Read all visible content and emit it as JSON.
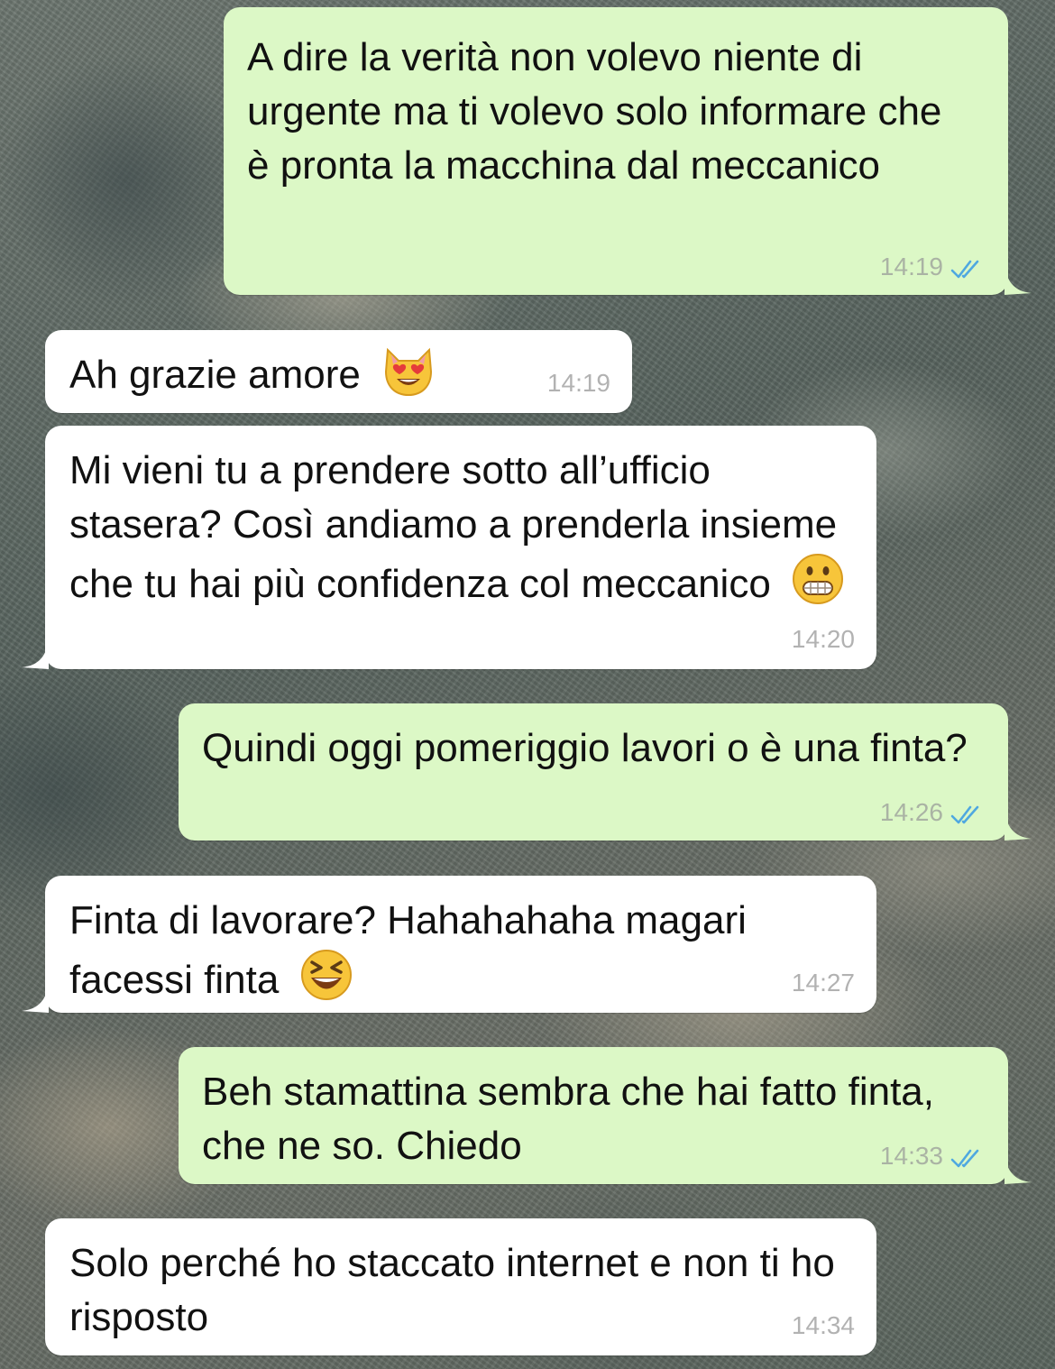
{
  "colors": {
    "outgoing_bubble": "#dcf8c6",
    "incoming_bubble": "#ffffff",
    "read_ticks": "#4fa8e0"
  },
  "messages": [
    {
      "direction": "outgoing",
      "text": "A dire la verità non volevo niente di urgente ma ti volevo solo informare che è pronta la macchina dal meccanico",
      "time": "14:19",
      "status": "read"
    },
    {
      "direction": "incoming",
      "text": "Ah grazie amore",
      "emoji": "smiling-cat-heart-eyes",
      "time": "14:19"
    },
    {
      "direction": "incoming",
      "text": "Mi vieni tu a prendere sotto all’ufficio stasera? Così andiamo a prenderla insieme che tu hai più confidenza col meccanico",
      "emoji": "grimacing-face",
      "time": "14:20"
    },
    {
      "direction": "outgoing",
      "text": "Quindi oggi pomeriggio lavori o è una finta?",
      "time": "14:26",
      "status": "read"
    },
    {
      "direction": "incoming",
      "text": "Finta di lavorare? Hahahahaha magari facessi finta",
      "emoji": "grinning-squinting-face",
      "time": "14:27"
    },
    {
      "direction": "outgoing",
      "text": "Beh stamattina sembra che hai fatto finta, che ne so. Chiedo",
      "time": "14:33",
      "status": "read"
    },
    {
      "direction": "incoming",
      "text": "Solo perché ho staccato internet e non ti ho risposto",
      "time": "14:34"
    }
  ]
}
